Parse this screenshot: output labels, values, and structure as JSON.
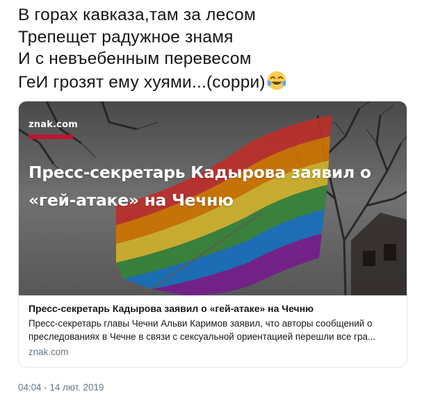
{
  "tweet": {
    "lines": [
      "В горах кавказа,там за лесом",
      "Трепещет радужное знамя",
      "И с невъебенным перевесом",
      "ГеИ грозят ему хуями...(сорри)"
    ],
    "emoji": "face-with-tears-of-joy-icon"
  },
  "card": {
    "image": {
      "logo_text": "znak.com",
      "headline": "Пресс-секретарь Кадырова заявил о «гей-атаке» на Чечню",
      "brand_color": "#c8102e"
    },
    "title": "Пресс-секретарь Кадырова заявил о «гей-атаке» на Чечню",
    "description_line1": "Пресс-секретарь главы Чечни Альви Каримов заявил, что авторы сообщений о",
    "description_line2": "преследованиях в Чечне в связи с сексуальной ориентацией перешли все гра...",
    "domain": "znak.com"
  },
  "timestamp": "04:04 - 14 лют. 2019"
}
